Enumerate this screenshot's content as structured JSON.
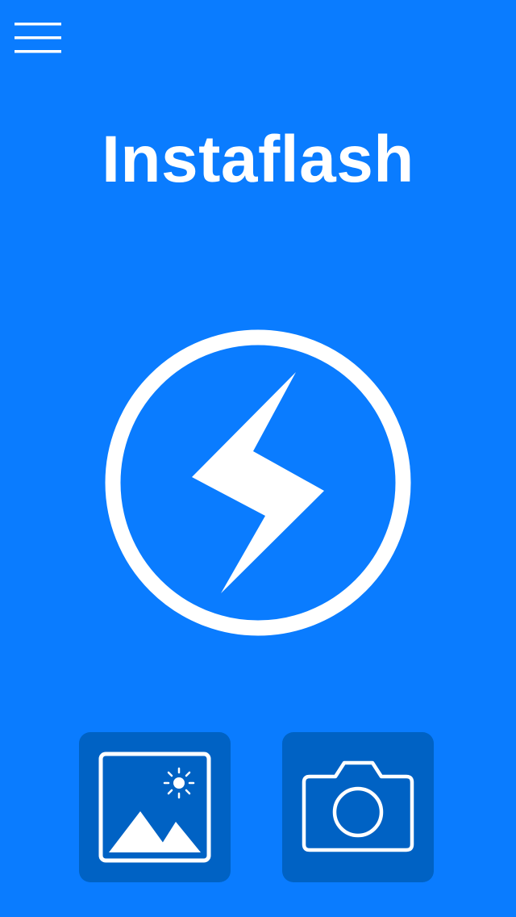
{
  "app": {
    "title": "Instaflash"
  },
  "colors": {
    "background": "#0A7CFF",
    "tile_background": "#0062C4",
    "foreground": "#FFFFFF"
  },
  "icons": {
    "menu": "hamburger-menu-icon",
    "flash": "lightning-bolt-icon",
    "gallery": "photo-gallery-icon",
    "camera": "camera-icon"
  }
}
